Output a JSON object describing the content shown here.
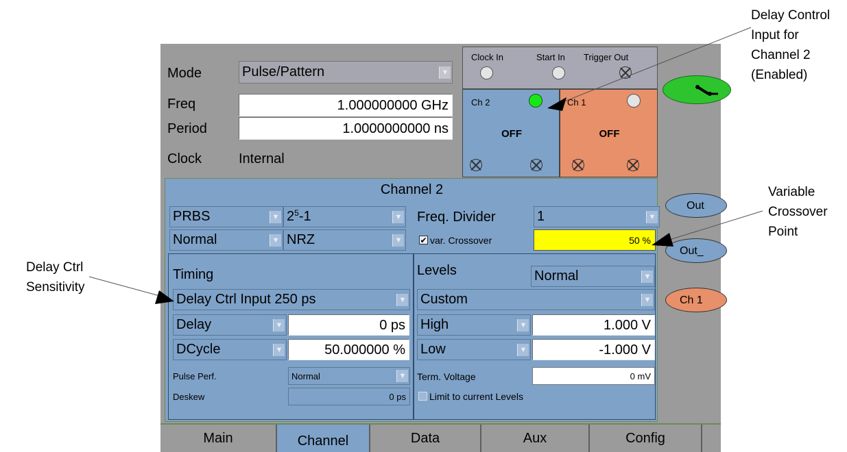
{
  "annotations": {
    "delay_control": [
      "Delay Control",
      "Input for",
      "Channel 2",
      "(Enabled)"
    ],
    "variable_crossover": [
      "Variable",
      "Crossover",
      "Point"
    ],
    "delay_ctrl_sensitivity": [
      "Delay Ctrl",
      "Sensitivity"
    ]
  },
  "top": {
    "mode_label": "Mode",
    "mode_value": "Pulse/Pattern",
    "freq_label": "Freq",
    "freq_value": "1.000000000 GHz",
    "period_label": "Period",
    "period_value": "1.0000000000 ns",
    "clock_label": "Clock",
    "clock_value": "Internal"
  },
  "connectors": {
    "clock_in": "Clock In",
    "start_in": "Start In",
    "trigger_out": "Trigger Out"
  },
  "ch2_tile": {
    "label": "Ch 2",
    "state": "OFF",
    "delay_led": "green"
  },
  "ch1_tile": {
    "label": "Ch 1",
    "state": "OFF"
  },
  "channel": {
    "title": "Channel 2",
    "pattern_type": "PRBS",
    "pattern_length_base": "2",
    "pattern_length_exp": "5",
    "pattern_length_suffix": "-1",
    "freq_divider_label": "Freq. Divider",
    "freq_divider_value": "1",
    "polarity": "Normal",
    "format": "NRZ",
    "var_crossover_checked": true,
    "var_crossover_label": "var. Crossover",
    "crossover_value": "50 %",
    "timing": {
      "title": "Timing",
      "delay_ctrl": "Delay Ctrl Input 250 ps",
      "delay_label": "Delay",
      "delay_value": "0 ps",
      "dcycle_label": "DCycle",
      "dcycle_value": "50.000000 %",
      "pulse_perf_label": "Pulse Perf.",
      "pulse_perf_value": "Normal",
      "deskew_label": "Deskew",
      "deskew_value": "0 ps"
    },
    "levels": {
      "title": "Levels",
      "mode": "Normal",
      "preset": "Custom",
      "high_label": "High",
      "high_value": "1.000 V",
      "low_label": "Low",
      "low_value": "-1.000 V",
      "term_label": "Term. Voltage",
      "term_value": "0 mV",
      "limit_label": "Limit to current Levels",
      "limit_checked": false
    }
  },
  "side_buttons": {
    "out": "Out",
    "out_bar": "Out_",
    "ch1": "Ch 1"
  },
  "tabs": [
    "Main",
    "Channel",
    "Data",
    "Aux",
    "Config"
  ],
  "active_tab": "Channel",
  "colors": {
    "panel_gray": "#9b9b9b",
    "channel_blue": "#7fa2c8",
    "ch1_orange": "#e8906a",
    "crossover_yellow": "#ffff00",
    "run_green": "#2ec42e"
  }
}
